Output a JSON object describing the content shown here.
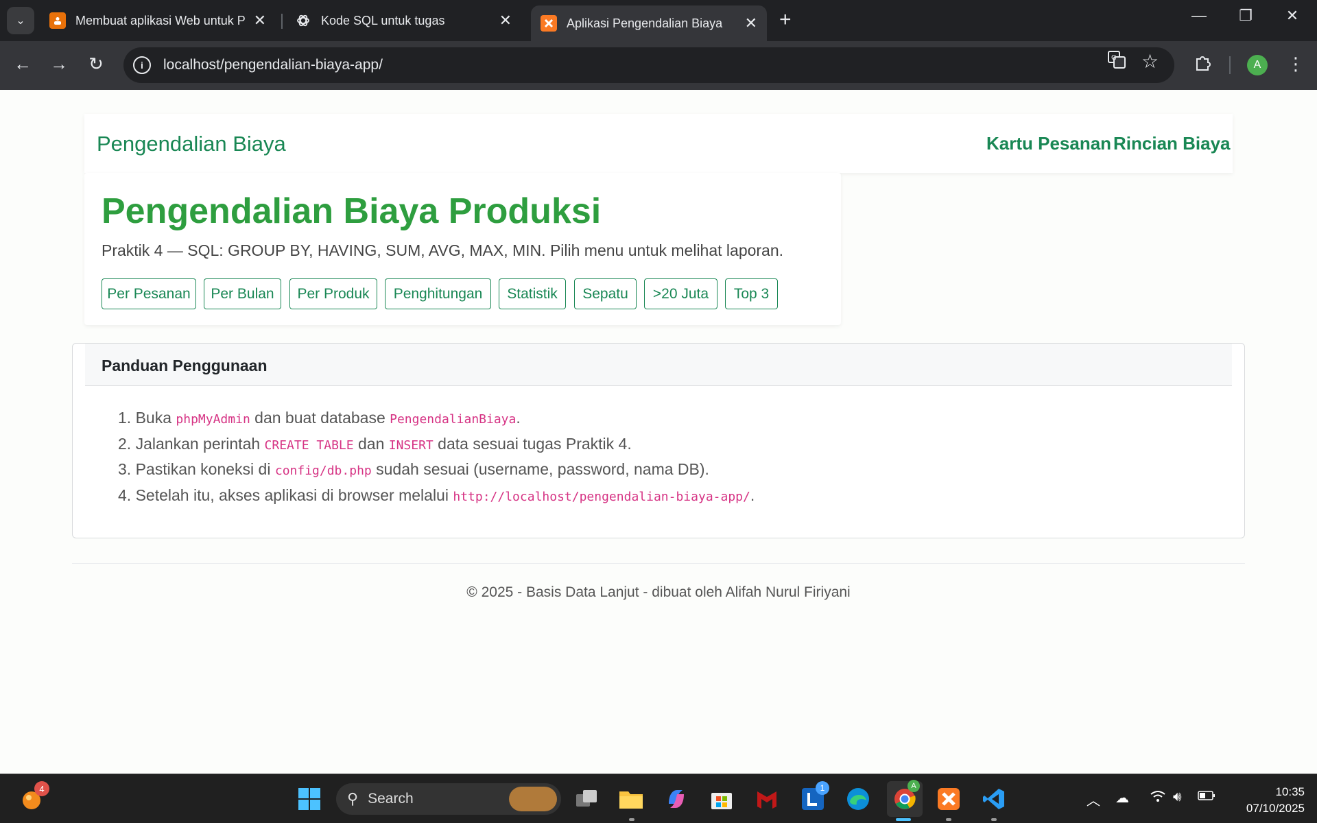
{
  "browser": {
    "tabs": [
      {
        "title": "Membuat aplikasi Web untuk P",
        "favicon": "slides-icon",
        "active": false
      },
      {
        "title": "Kode SQL untuk tugas",
        "favicon": "chatgpt-icon",
        "active": false
      },
      {
        "title": "Aplikasi Pengendalian Biaya",
        "favicon": "xampp-icon",
        "active": true
      }
    ],
    "url": "localhost/pengendalian-biaya-app/",
    "profile_initial": "A"
  },
  "navbar": {
    "brand": "Pengendalian Biaya",
    "links": [
      "Kartu Pesanan",
      "Rincian Biaya"
    ]
  },
  "hero": {
    "title": "Pengendalian Biaya Produksi",
    "subtitle": "Praktik 4 — SQL: GROUP BY, HAVING, SUM, AVG, MAX, MIN. Pilih menu untuk melihat laporan.",
    "buttons": [
      "Per Pesanan",
      "Per Bulan",
      "Per Produk",
      "Penghitungan",
      "Statistik",
      "Sepatu",
      ">20 Juta",
      "Top 3"
    ]
  },
  "guide": {
    "title": "Panduan Penggunaan",
    "steps": [
      {
        "num": "1.",
        "t1": "Buka ",
        "c1": "phpMyAdmin",
        "t2": " dan buat database ",
        "c2": "PengendalianBiaya",
        "t3": "."
      },
      {
        "num": "2.",
        "t1": "Jalankan perintah ",
        "c1": "CREATE TABLE",
        "t2": " dan ",
        "c2": "INSERT",
        "t3": " data sesuai tugas Praktik 4."
      },
      {
        "num": "3.",
        "t1": "Pastikan koneksi di ",
        "c1": "config/db.php",
        "t2": " sudah sesuai (username, password, nama DB).",
        "c2": "",
        "t3": ""
      },
      {
        "num": "4.",
        "t1": "Setelah itu, akses aplikasi di browser melalui ",
        "c1": "http://localhost/pengendalian-biaya-app/",
        "t2": ".",
        "c2": "",
        "t3": ""
      }
    ]
  },
  "footer": {
    "text": "© 2025 - Basis Data Lanjut - dibuat oleh Alifah Nurul Firiyani"
  },
  "taskbar": {
    "search_label": "Search",
    "notification_badge": "4",
    "lens_badge": "1",
    "time": "10:35",
    "date": "07/10/2025"
  },
  "colors": {
    "brand_green": "#198754",
    "title_green": "#2e9e3f",
    "code_pink": "#d63384"
  }
}
